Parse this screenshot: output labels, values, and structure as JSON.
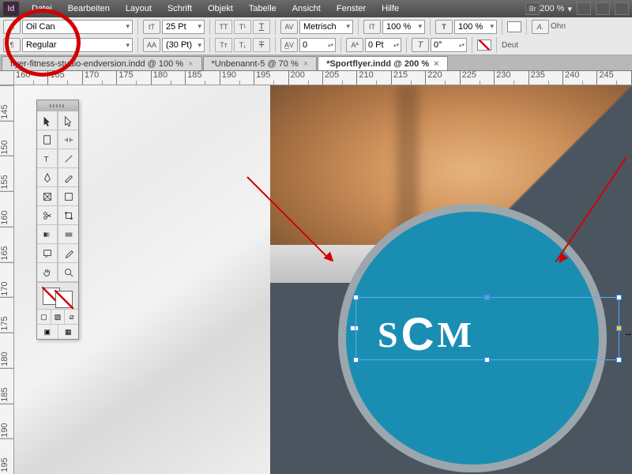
{
  "app": {
    "logo": "Id"
  },
  "menu": {
    "items": [
      "Datei",
      "Bearbeiten",
      "Layout",
      "Schrift",
      "Objekt",
      "Tabelle",
      "Ansicht",
      "Fenster",
      "Hilfe"
    ],
    "bridge_label": "Br",
    "zoom": "200 %"
  },
  "options": {
    "font_family": "Oil Can",
    "font_style": "Regular",
    "font_size": "25 Pt",
    "leading": "(30 Pt)",
    "kerning_method": "Metrisch",
    "tracking": "0",
    "vscale": "100 %",
    "hscale": "100 %",
    "baseline": "0 Pt",
    "skew": "0°",
    "lang_hint": "Ohn",
    "lang": "Deut"
  },
  "tabs": [
    {
      "label": "flyer-fitness-studio-endversion.indd @ 100 %",
      "active": false
    },
    {
      "label": "*Unbenannt-5 @ 70 %",
      "active": false
    },
    {
      "label": "*Sportflyer.indd @ 200 %",
      "active": true
    }
  ],
  "ruler": {
    "h": [
      "160",
      "165",
      "170",
      "175",
      "180",
      "185",
      "190",
      "195",
      "200",
      "205",
      "210",
      "215",
      "220",
      "225",
      "230",
      "235",
      "240",
      "245"
    ],
    "v": [
      "145",
      "150",
      "155",
      "160",
      "165",
      "170",
      "175",
      "180",
      "185",
      "190",
      "195"
    ]
  },
  "canvas": {
    "logo_text": "SCM"
  },
  "toolbox": {
    "tools": [
      "selection",
      "direct-selection",
      "page",
      "gap",
      "type",
      "line",
      "pen",
      "pencil",
      "rectangle-frame",
      "rectangle",
      "scissors",
      "free-transform",
      "gradient-swatch",
      "gradient-feather",
      "note",
      "eyedropper",
      "hand",
      "zoom"
    ]
  }
}
